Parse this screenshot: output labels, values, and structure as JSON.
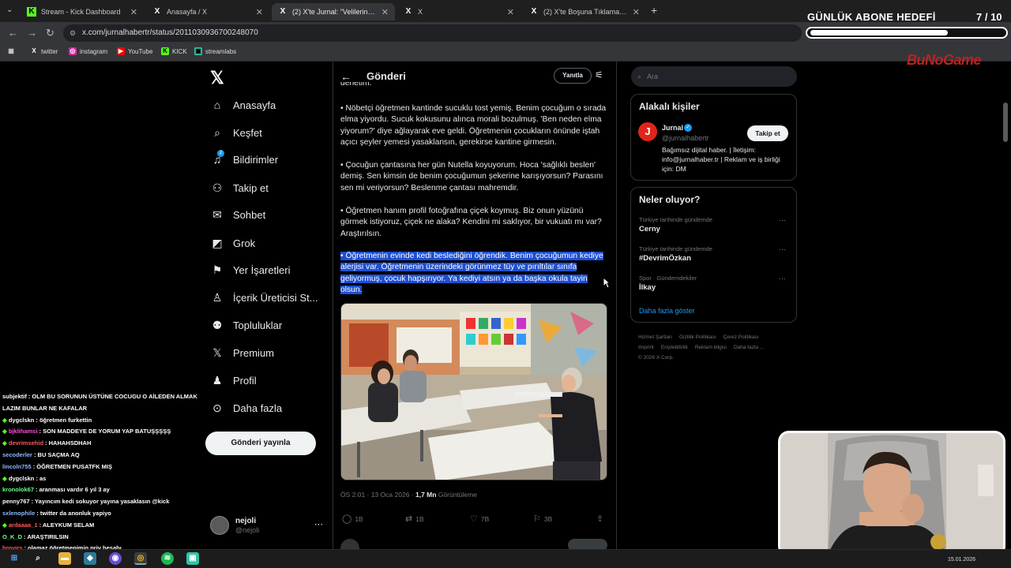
{
  "browser": {
    "tabs": [
      {
        "title": "Stream - Kick Dashboard",
        "icon": "kick-icon"
      },
      {
        "title": "Anasayfa / X",
        "icon": "x-icon"
      },
      {
        "title": "(2) X'te Jurnal: \"Velilerin, öğretmenl",
        "icon": "x-icon"
      },
      {
        "title": "X",
        "icon": "x-icon"
      },
      {
        "title": "(2) X'te Boşuna Tıklama: \"Türkiye",
        "icon": "x-icon"
      }
    ],
    "new_tab": "+",
    "url": "x.com/jurnalhabertr/status/2011030936700248070",
    "bookmarks": [
      "twitter",
      "instagram",
      "YouTube",
      "KICK",
      "streamlabs"
    ]
  },
  "overlay": {
    "goal_title": "GÜNLÜK ABONE HEDEFİ",
    "goal_count": "7 / 10",
    "goal_progress": 0.7,
    "logo": "BuNoGame"
  },
  "nav": {
    "items": [
      "Anasayfa",
      "Keşfet",
      "Bildirimler",
      "Takip et",
      "Sohbet",
      "Grok",
      "Yer İşaretleri",
      "İçerik Üreticisi St...",
      "Topluluklar",
      "Premium",
      "Profil",
      "Daha fazla"
    ],
    "notification_badge": "2",
    "post_button": "Gönderi yayınla",
    "profile": {
      "name": "nejoli",
      "handle": "@nejoli",
      "more": "⋯"
    }
  },
  "chat": [
    {
      "user": "subjektif",
      "color": "#ffffff",
      "text": ": OLM BU SORUNUN ÜSTÜNE COCUGU O AİLEDEN ALMAK"
    },
    {
      "user": "",
      "color": "#ffffff",
      "text": "LAZIM BUNLAR NE KAFALAR"
    },
    {
      "user": "dygclskn",
      "color": "#ffffff",
      "text": ": öğretmen furkettin",
      "badge": true
    },
    {
      "user": "bjklihamsi",
      "color": "#ff4fd8",
      "text": ": SON MADDEYE DE YORUM YAP BATUŞŞŞŞŞ",
      "badge": true
    },
    {
      "user": "devrimsehid",
      "color": "#ff5a5a",
      "text": ": HAHAHSDHAH",
      "badge": true
    },
    {
      "user": "secoderler",
      "color": "#8fb8ff",
      "text": ": BU SAÇMA AQ"
    },
    {
      "user": "lincoln755",
      "color": "#8fb8ff",
      "text": ": ÖĞRETMEN PUSATFK MIŞ"
    },
    {
      "user": "dygclskn",
      "color": "#ffffff",
      "text": ": as",
      "badge": true
    },
    {
      "user": "kronolok67",
      "color": "#6bff8a",
      "text": ": aranması vardır 6 yıl 3 ay"
    },
    {
      "user": "penny767",
      "color": "#ffffff",
      "text": ": Yayıncım kedi sokuyor yayına yasaklasın @kick"
    },
    {
      "user": "sxlenophile",
      "color": "#8fb8ff",
      "text": ": twitter da anonluk yapiyo"
    },
    {
      "user": "ardaaaa_1",
      "color": "#ff5a5a",
      "text": ": ALEYKUM SELAM",
      "badge": true
    },
    {
      "user": "O_K_D",
      "color": "#6bff8a",
      "text": ": ARAŞTIRILSIN"
    },
    {
      "user": "hroyjrs",
      "color": "#ff5a5a",
      "text": ": olamaz öğretmenimin priv hesabı"
    }
  ],
  "post": {
    "back": "←",
    "title": "Gönderi",
    "reply_button": "Yanıtla",
    "top_fragment": "denetim.",
    "paragraphs": [
      "• Nöbetçi öğretmen kantinde sucuklu tost yemiş. Benim çocuğum o sırada elma yiyordu. Sucuk kokusunu alınca morali bozulmuş. 'Ben neden elma yiyorum?' diye ağlayarak eve geldi. Öğretmenin çocukların önünde iştah açıcı şeyler yemesi yasaklansın, gerekirse kantine girmesin.",
      "• Çocuğun çantasına her gün Nutella koyuyorum. Hoca 'sağlıklı beslen' demiş. Sen kimsin de benim çocuğumun şekerine karışıyorsun? Parasını sen mi veriyorsun? Beslenme çantası mahremdir.",
      "• Öğretmen hanım profil fotoğrafına çiçek koymuş. Biz onun yüzünü görmek istiyoruz, çiçek ne alaka? Kendini mi saklıyor, bir vukuatı mı var? Araştırılsın."
    ],
    "selected_paragraph": "• Öğretmenin evinde kedi beslediğini öğrendik. Benim çocuğumun kediye alerjisi var. Öğretmenin üzerindeki görünmez tüy ve pırıltılar sınıfa geliyormuş, çocuk hapşırıyor. Ya kediyi atsın ya da başka okula tayin olsun.",
    "meta_time": "ÖS 2:01 · 13 Oca 2026 · ",
    "meta_views": "1,7 Mn",
    "meta_views_label": " Görüntüleme",
    "actions": {
      "replies": "1B",
      "reposts": "1B",
      "likes": "7B",
      "bookmarks": "3B"
    }
  },
  "sidebar": {
    "search_placeholder": "Ara",
    "related_title": "Alakalı kişiler",
    "account": {
      "avatar": "J",
      "name": "Jurnal",
      "handle": "@jurnalhabertr",
      "follow": "Takip et",
      "bio": "Bağımsız dijital haber. | İletişim: info@jurnalhaber.tr | Reklam ve iş birliği için: DM"
    },
    "trends_title": "Neler oluyor?",
    "trends": [
      {
        "context": "Türkiye tarihinde gündemde",
        "name": "Cerny"
      },
      {
        "context": "Türkiye tarihinde gündemde",
        "name": "#DevrimÖzkan"
      },
      {
        "context": "Spor · Gündemdekiler",
        "name": "İlkay"
      }
    ],
    "show_more": "Daha fazla göster",
    "footer": [
      "Hizmet Şartları",
      "Gizlilik Politikası",
      "Çerez Politikası",
      "Imprint",
      "Erişilebilirlik",
      "Reklam bilgisi",
      "Daha fazla ...",
      "© 2026 X Corp."
    ]
  },
  "taskbar": {
    "date": "15.01.2026"
  }
}
